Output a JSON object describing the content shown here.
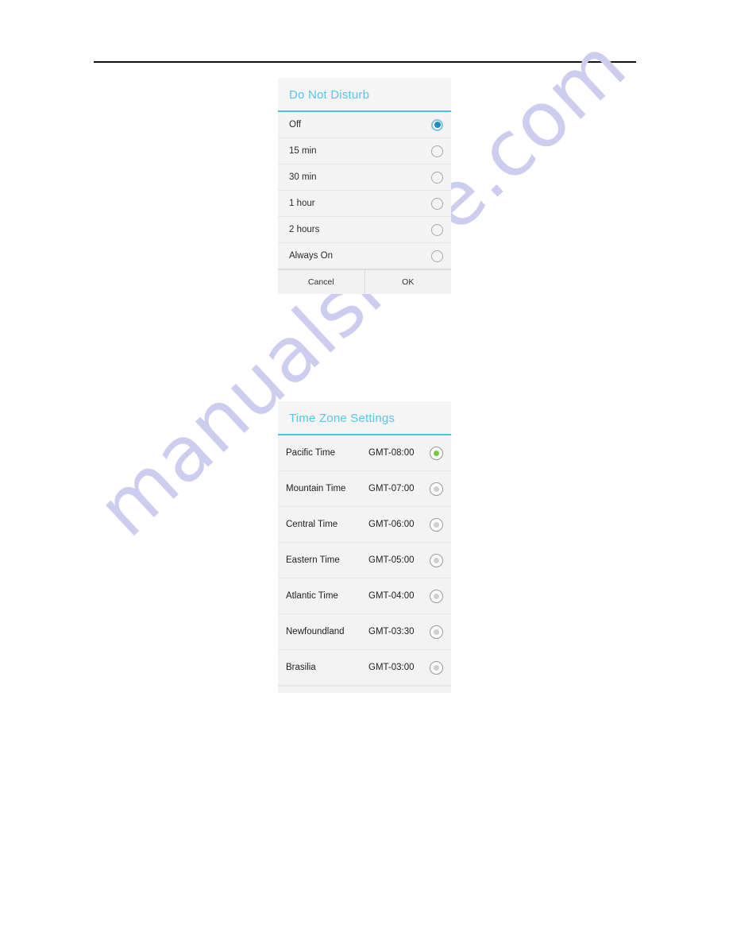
{
  "page": {
    "watermark_text": "manualshive.com",
    "watermark_color": "#cdcdef",
    "accent_cyan": "#57c6ea",
    "accent_underline": "#4ec3e0",
    "radio_selected_blue": "#1a8fc4",
    "radio_selected_green": "#6fcf3a"
  },
  "dnd_dialog": {
    "title": "Do Not Disturb",
    "options": [
      {
        "label": "Off",
        "selected": true
      },
      {
        "label": "15 min",
        "selected": false
      },
      {
        "label": "30 min",
        "selected": false
      },
      {
        "label": "1 hour",
        "selected": false
      },
      {
        "label": "2 hours",
        "selected": false
      },
      {
        "label": "Always On",
        "selected": false
      }
    ],
    "buttons": {
      "cancel": "Cancel",
      "ok": "OK"
    }
  },
  "timezone_dialog": {
    "title": "Time Zone Settings",
    "zones": [
      {
        "name": "Pacific Time",
        "offset": "GMT-08:00",
        "selected": true
      },
      {
        "name": "Mountain Time",
        "offset": "GMT-07:00",
        "selected": false
      },
      {
        "name": "Central Time",
        "offset": "GMT-06:00",
        "selected": false
      },
      {
        "name": "Eastern Time",
        "offset": "GMT-05:00",
        "selected": false
      },
      {
        "name": "Atlantic Time",
        "offset": "GMT-04:00",
        "selected": false
      },
      {
        "name": "Newfoundland",
        "offset": "GMT-03:30",
        "selected": false
      },
      {
        "name": "Brasilia",
        "offset": "GMT-03:00",
        "selected": false
      }
    ]
  }
}
